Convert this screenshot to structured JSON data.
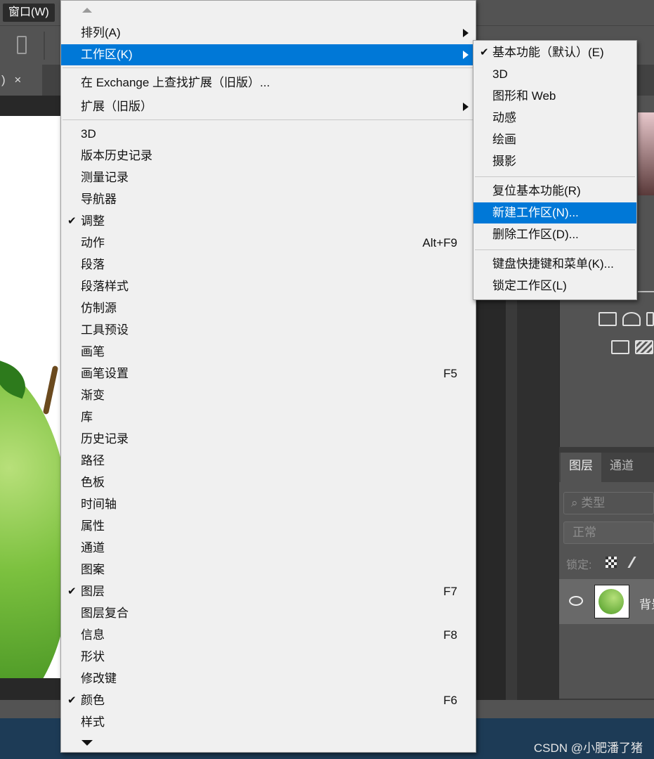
{
  "menubar": {
    "window_menu": "窗口(W)"
  },
  "document_tab": {
    "close": "×",
    "paren": ")"
  },
  "main_menu": {
    "items": [
      {
        "label": "排列(A)",
        "submenu": true
      },
      {
        "label": "工作区(K)",
        "submenu": true,
        "highlighted": true
      },
      {
        "label": "在 Exchange 上查找扩展（旧版）..."
      },
      {
        "label": "扩展（旧版）",
        "submenu": true
      },
      {
        "label": "3D"
      },
      {
        "label": "版本历史记录"
      },
      {
        "label": "测量记录"
      },
      {
        "label": "导航器"
      },
      {
        "label": "调整",
        "checked": true
      },
      {
        "label": "动作",
        "shortcut": "Alt+F9"
      },
      {
        "label": "段落"
      },
      {
        "label": "段落样式"
      },
      {
        "label": "仿制源"
      },
      {
        "label": "工具预设"
      },
      {
        "label": "画笔"
      },
      {
        "label": "画笔设置",
        "shortcut": "F5"
      },
      {
        "label": "渐变"
      },
      {
        "label": "库"
      },
      {
        "label": "历史记录"
      },
      {
        "label": "路径"
      },
      {
        "label": "色板"
      },
      {
        "label": "时间轴"
      },
      {
        "label": "属性"
      },
      {
        "label": "通道"
      },
      {
        "label": "图案"
      },
      {
        "label": "图层",
        "checked": true,
        "shortcut": "F7"
      },
      {
        "label": "图层复合"
      },
      {
        "label": "信息",
        "shortcut": "F8"
      },
      {
        "label": "形状"
      },
      {
        "label": "修改键"
      },
      {
        "label": "颜色",
        "checked": true,
        "shortcut": "F6"
      },
      {
        "label": "样式"
      }
    ]
  },
  "workspace_submenu": {
    "items": [
      {
        "label": "基本功能（默认）(E)",
        "checked": true
      },
      {
        "label": "3D"
      },
      {
        "label": "图形和 Web"
      },
      {
        "label": "动感"
      },
      {
        "label": "绘画"
      },
      {
        "label": "摄影"
      },
      {
        "label": "复位基本功能(R)"
      },
      {
        "label": "新建工作区(N)...",
        "highlighted": true
      },
      {
        "label": "删除工作区(D)..."
      },
      {
        "label": "键盘快捷键和菜单(K)..."
      },
      {
        "label": "锁定工作区(L)"
      }
    ]
  },
  "layers_panel": {
    "tab_layers": "图层",
    "tab_channels": "通道",
    "filter_placeholder": "类型",
    "blend_mode": "正常",
    "lock_label": "锁定:",
    "layer_name": "背景"
  },
  "watermark": "CSDN @小肥潘了猪",
  "colors": {
    "highlight": "#0078d7",
    "menu_bg": "#f0f0f0",
    "app_bg": "#535353"
  }
}
